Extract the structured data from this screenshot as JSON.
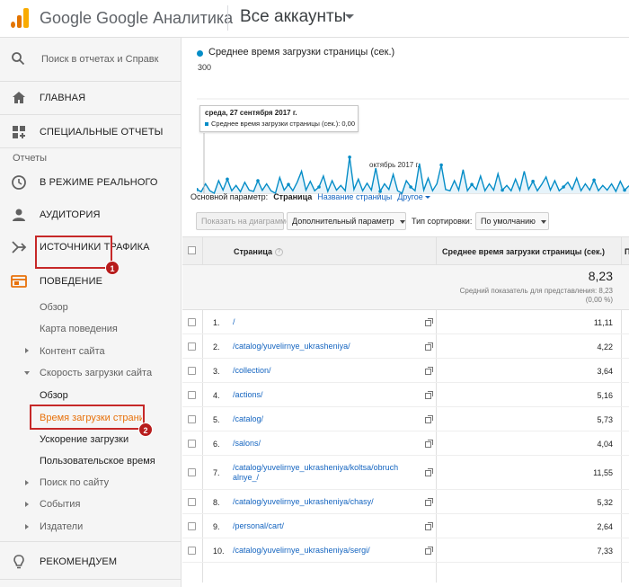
{
  "header": {
    "app_title": "Google Google Аналитика",
    "account": "Все аккаунты",
    "logo_colors": [
      "#f9ab00",
      "#e37400",
      "#e37400"
    ]
  },
  "sidebar": {
    "search_placeholder": "Поиск в отчетах и Справк",
    "home": "ГЛАВНАЯ",
    "custom_reports": "СПЕЦИАЛЬНЫЕ ОТЧЕТЫ",
    "reports_label": "Отчеты",
    "realtime": "В РЕЖИМЕ РЕАЛЬНОГО",
    "audience": "АУДИТОРИЯ",
    "acquisition": "ИСТОЧНИКИ ТРАФИКА",
    "behavior": "ПОВЕДЕНИЕ",
    "behavior_items": {
      "overview": "Обзор",
      "flow": "Карта поведения",
      "site_content": "Контент сайта",
      "site_speed": "Скорость загрузки сайта",
      "speed_overview": "Обзор",
      "page_timings": "Время загрузки страниц",
      "speed_suggestions": "Ускорение загрузки",
      "user_timings": "Пользовательское время",
      "site_search": "Поиск по сайту",
      "events": "События",
      "publisher": "Издатели"
    },
    "recommended": "РЕКОМЕНДУЕМ",
    "badge1": "1",
    "badge2": "2",
    "accent_color": "#e8710a",
    "highlight_color": "#c62828"
  },
  "chart": {
    "legend": "Среднее время загрузки страницы (сек.)",
    "ymax_label": "300",
    "xaxis_label": "октябрь 2017 г.",
    "tooltip_date": "среда, 27 сентября 2017 г.",
    "tooltip_value": "Среднее время загрузки страницы (сек.): 0,00",
    "series_color": "#058dc7"
  },
  "chart_data": {
    "type": "area",
    "title": "",
    "xlabel": "октябрь 2017 г.",
    "ylabel": "Среднее время загрузки страницы (сек.)",
    "ylim": [
      0,
      300
    ],
    "series": [
      {
        "name": "Среднее время загрузки страницы (сек.)",
        "values": [
          12,
          5,
          30,
          8,
          0,
          40,
          10,
          45,
          8,
          25,
          5,
          35,
          10,
          6,
          40,
          9,
          30,
          8,
          0,
          50,
          10,
          28,
          8,
          35,
          70,
          10,
          38,
          8,
          20,
          55,
          6,
          40,
          10,
          25,
          8,
          115,
          12,
          45,
          8,
          32,
          10,
          80,
          6,
          30,
          12,
          60,
          8,
          0,
          40,
          20,
          8,
          95,
          10,
          48,
          8,
          30,
          90,
          12,
          8,
          40,
          10,
          75,
          8,
          28,
          12,
          55,
          8,
          30,
          10,
          62,
          10,
          25,
          8,
          45,
          10,
          70,
          12,
          38,
          8,
          28,
          52,
          10,
          40,
          8,
          20,
          35,
          12,
          48,
          8,
          30,
          10,
          42,
          8,
          25,
          10,
          30,
          6,
          38,
          10,
          24
        ]
      }
    ],
    "grid": true,
    "legend": "top-left"
  },
  "dimensions": {
    "label": "Основной параметр:",
    "current": "Страница",
    "option1": "Название страницы",
    "other": "Другое"
  },
  "toolbar": {
    "plot_rows": "Показать на диаграмме",
    "secondary_dim": "Дополнительный параметр",
    "sort_type_label": "Тип сортировки:",
    "sort_value": "По умолчанию"
  },
  "table": {
    "col_page": "Страница",
    "col_metric": "Среднее время загрузки страницы (сек.)",
    "col_next": "П",
    "help_glyph": "?",
    "total_value": "8,23",
    "total_sub": "Средний показатель для представления: 8,23",
    "total_sub2": "(0,00 %)",
    "rows": [
      {
        "n": "1.",
        "page": "/",
        "value": "11,11"
      },
      {
        "n": "2.",
        "page": "/catalog/yuvelirnye_ukrasheniya/",
        "value": "4,22"
      },
      {
        "n": "3.",
        "page": "/collection/",
        "value": "3,64"
      },
      {
        "n": "4.",
        "page": "/actions/",
        "value": "5,16"
      },
      {
        "n": "5.",
        "page": "/catalog/",
        "value": "5,73"
      },
      {
        "n": "6.",
        "page": "/salons/",
        "value": "4,04"
      },
      {
        "n": "7.",
        "page": "/catalog/yuvelirnye_ukrasheniya/koltsa/obruch",
        "page2": "alnye_/",
        "value": "11,55"
      },
      {
        "n": "8.",
        "page": "/catalog/yuvelirnye_ukrasheniya/chasy/",
        "value": "5,32"
      },
      {
        "n": "9.",
        "page": "/personal/cart/",
        "value": "2,64"
      },
      {
        "n": "10.",
        "page": "/catalog/yuvelirnye_ukrasheniya/sergi/",
        "value": "7,33"
      }
    ]
  }
}
